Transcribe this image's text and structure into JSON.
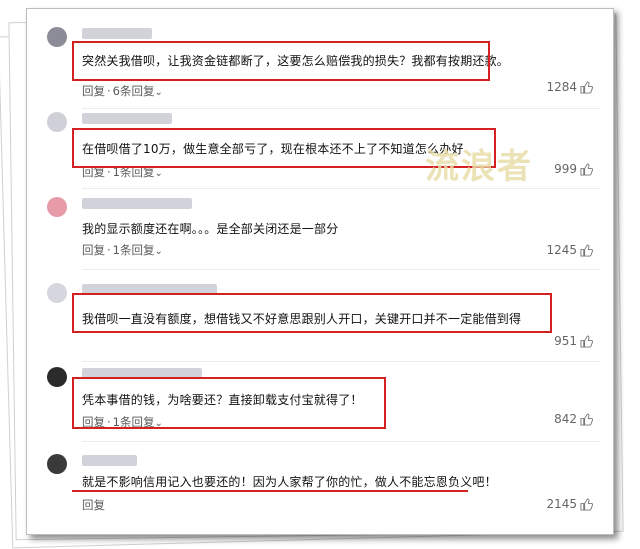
{
  "comments": [
    {
      "text": "突然关我借呗，让我资金链都断了，这要怎么赔偿我的损失？我都有按期还款。",
      "reply": "回复",
      "sep": "·",
      "count": "6条回复",
      "likes": "1284"
    },
    {
      "text": "在借呗借了10万，做生意全部亏了，现在根本还不上了不知道怎么办好",
      "reply": "回复",
      "sep": "·",
      "count": "1条回复",
      "likes": "999"
    },
    {
      "text": "我的显示额度还在啊。。。是全部关闭还是一部分",
      "reply": "回复",
      "sep": "·",
      "count": "1条回复",
      "likes": "1245"
    },
    {
      "text": "我借呗一直没有额度，想借钱又不好意思跟别人开口，关键开口并不一定能借到得",
      "reply": "回复",
      "sep": "·",
      "count": "1条回复",
      "likes": "951"
    },
    {
      "text": "凭本事借的钱，为啥要还？直接卸载支付宝就得了！",
      "reply": "回复",
      "sep": "·",
      "count": "1条回复",
      "likes": "842"
    },
    {
      "text": "就是不影响信用记入也要还的！因为人家帮了你的忙，做人不能忘恩负义吧！",
      "reply": "回复",
      "likes": "2145"
    }
  ],
  "watermark": "流浪者",
  "colors": {
    "highlight": "#d32121",
    "meta": "#5a5a5a",
    "likes": "#666666"
  }
}
